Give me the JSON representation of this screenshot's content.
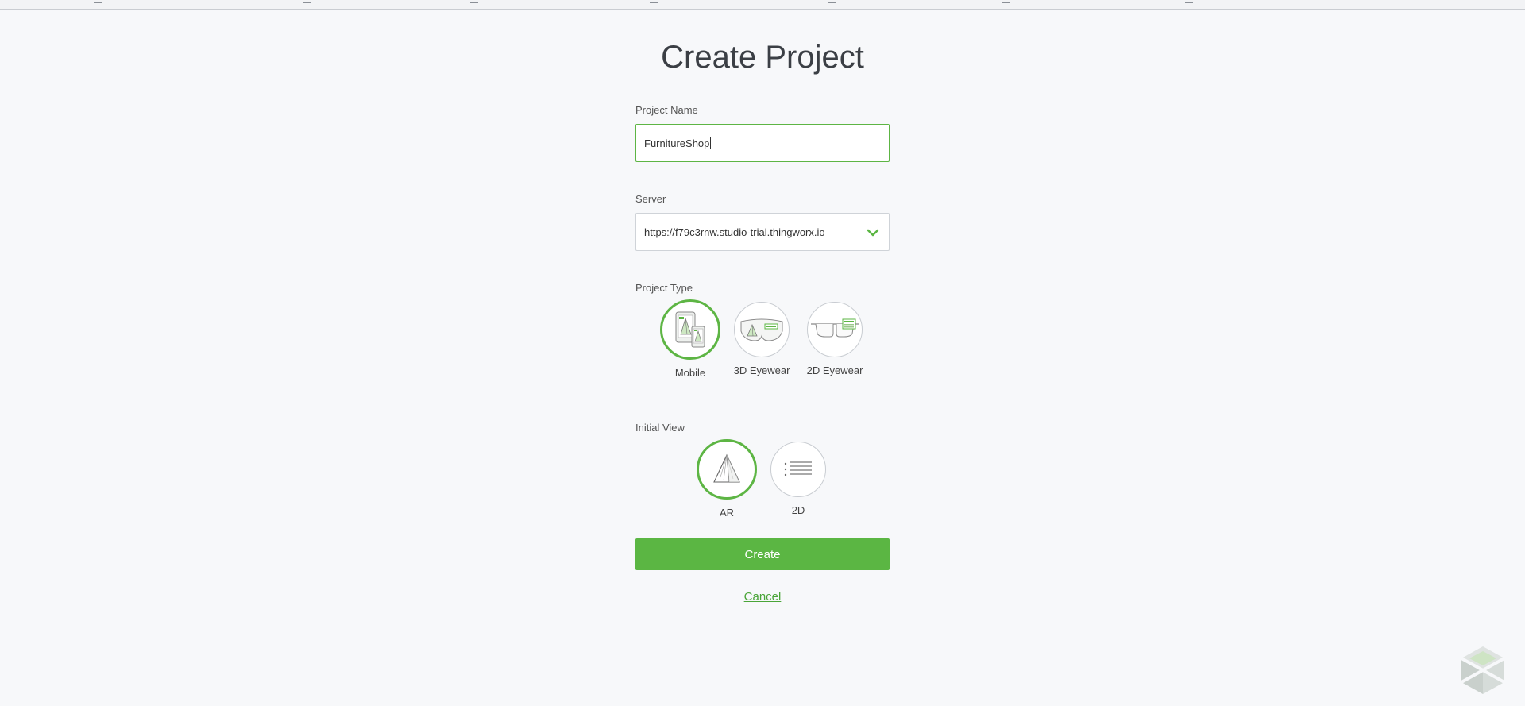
{
  "page": {
    "title": "Create Project"
  },
  "project_name": {
    "label": "Project Name",
    "value": "FurnitureShop"
  },
  "server": {
    "label": "Server",
    "selected": "https://f79c3rnw.studio-trial.thingworx.io"
  },
  "project_type": {
    "label": "Project Type",
    "options": [
      {
        "label": "Mobile",
        "icon": "mobile-devices-icon",
        "selected": true
      },
      {
        "label": "3D Eyewear",
        "icon": "3d-eyewear-icon",
        "selected": false
      },
      {
        "label": "2D Eyewear",
        "icon": "2d-eyewear-icon",
        "selected": false
      }
    ]
  },
  "initial_view": {
    "label": "Initial View",
    "options": [
      {
        "label": "AR",
        "icon": "pyramid-icon",
        "selected": true
      },
      {
        "label": "2D",
        "icon": "list-icon",
        "selected": false
      }
    ]
  },
  "actions": {
    "create_label": "Create",
    "cancel_label": "Cancel"
  },
  "colors": {
    "accent": "#5bb643",
    "background": "#f7f8fa"
  }
}
